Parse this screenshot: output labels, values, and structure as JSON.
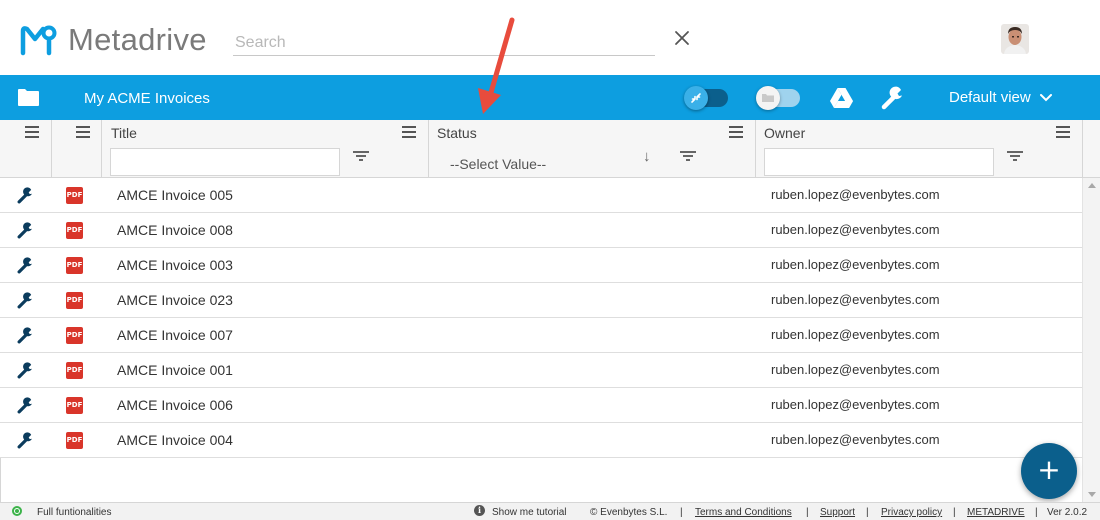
{
  "app": {
    "name": "Metadrive",
    "brand_color": "#0d9ee0",
    "accent_dark": "#0b5f8c"
  },
  "header": {
    "search_placeholder": "Search",
    "clear_icon": "close-icon",
    "avatar_icon": "user-avatar"
  },
  "toolbar": {
    "folder_icon": "folder-icon",
    "folder_title": "My ACME Invoices",
    "toggle_compact": {
      "icon": "compress-icon",
      "on": true
    },
    "toggle_folders": {
      "icon": "folder-icon",
      "on": false
    },
    "drive_icon": "google-drive-icon",
    "settings_icon": "wrench-icon",
    "view_label": "Default view"
  },
  "grid": {
    "columns": [
      {
        "key": "actions",
        "label": ""
      },
      {
        "key": "type",
        "label": ""
      },
      {
        "key": "title",
        "label": "Title"
      },
      {
        "key": "status",
        "label": "Status"
      },
      {
        "key": "owner",
        "label": "Owner"
      }
    ],
    "status_filter_placeholder": "--Select Value--",
    "sort_indicator": "↓",
    "file_badge": "PDF",
    "rows": [
      {
        "title": "AMCE Invoice 005",
        "status": "",
        "owner": "ruben.lopez@evenbytes.com"
      },
      {
        "title": "AMCE Invoice 008",
        "status": "",
        "owner": "ruben.lopez@evenbytes.com"
      },
      {
        "title": "AMCE Invoice 003",
        "status": "",
        "owner": "ruben.lopez@evenbytes.com"
      },
      {
        "title": "AMCE Invoice 023",
        "status": "",
        "owner": "ruben.lopez@evenbytes.com"
      },
      {
        "title": "AMCE Invoice 007",
        "status": "",
        "owner": "ruben.lopez@evenbytes.com"
      },
      {
        "title": "AMCE Invoice 001",
        "status": "",
        "owner": "ruben.lopez@evenbytes.com"
      },
      {
        "title": "AMCE Invoice 006",
        "status": "",
        "owner": "ruben.lopez@evenbytes.com"
      },
      {
        "title": "AMCE Invoice 004",
        "status": "",
        "owner": "ruben.lopez@evenbytes.com"
      }
    ]
  },
  "fab": {
    "label": "+"
  },
  "footer": {
    "status_text": "Full funtionalities",
    "tutorial": "Show me tutorial",
    "copyright": "© Evenbytes S.L.",
    "sep": "|",
    "terms": "Terms and Conditions",
    "support": "Support",
    "privacy": "Privacy policy",
    "metadrive": "METADRIVE",
    "version": "Ver 2.0.2"
  }
}
